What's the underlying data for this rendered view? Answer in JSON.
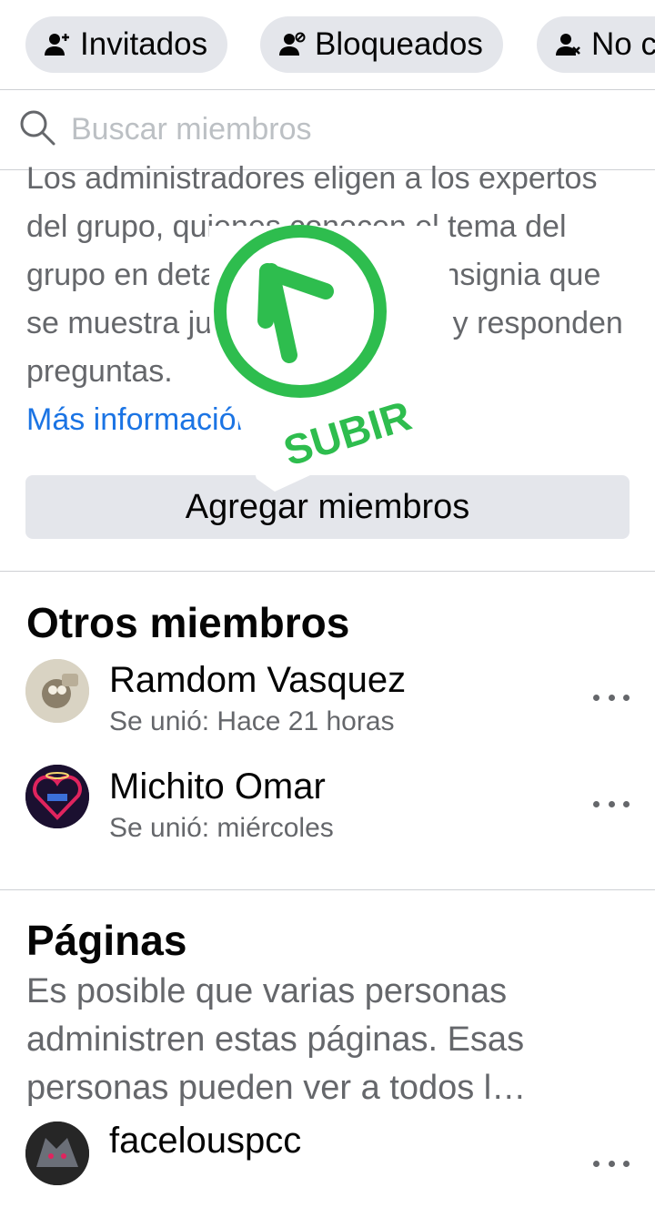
{
  "filters": [
    {
      "label": "Invitados",
      "icon": "person-add-icon"
    },
    {
      "label": "Bloqueados",
      "icon": "person-blocked-icon"
    },
    {
      "label": "No c",
      "icon": "person-remove-icon"
    }
  ],
  "search": {
    "placeholder": "Buscar miembros"
  },
  "experts": {
    "description": "Los administradores eligen a los expertos del grupo, quienes conocen el tema del grupo en detalle, reciben una insignia que se muestra junto a su nombre, y responden preguntas.",
    "more_link": "Más información",
    "add_button": "Agregar miembros"
  },
  "overlay": {
    "label": "SUBIR",
    "color": "#2ebd4e"
  },
  "other_members": {
    "title": "Otros miembros",
    "members": [
      {
        "name": "Ramdom Vasquez",
        "joined": "Se unió: Hace 21 horas"
      },
      {
        "name": "Michito Omar",
        "joined": "Se unió: miércoles"
      }
    ]
  },
  "pages": {
    "title": "Páginas",
    "description": "Es posible que varias personas administren estas páginas. Esas personas pueden ver a todos l…",
    "items": [
      {
        "name": "facelouspcc"
      }
    ]
  },
  "colors": {
    "link": "#1b74e4",
    "chip_bg": "#e4e6eb",
    "secondary_text": "#65676b"
  }
}
